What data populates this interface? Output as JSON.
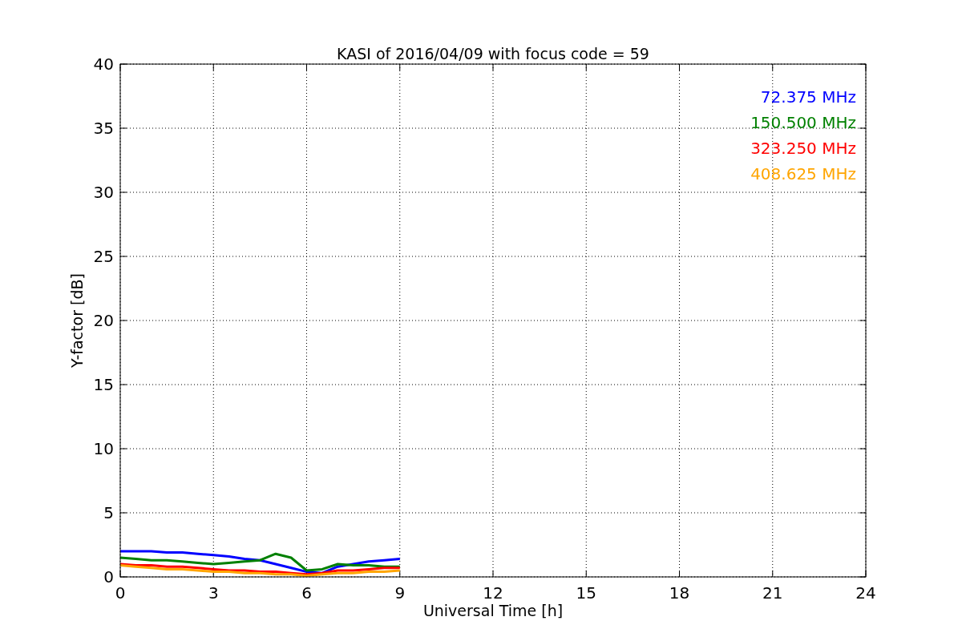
{
  "chart_data": {
    "type": "line",
    "title": "KASI of 2016/04/09 with focus code = 59",
    "xlabel": "Universal Time [h]",
    "ylabel": "Y-factor [dB]",
    "x": [
      0,
      0.5,
      1,
      1.5,
      2,
      2.5,
      3,
      3.5,
      4,
      4.5,
      5,
      5.5,
      6,
      6.5,
      7,
      7.5,
      8,
      8.5,
      9
    ],
    "series": [
      {
        "name": "72.375 MHz",
        "color": "#0000ff",
        "values": [
          2.0,
          2.0,
          2.0,
          1.9,
          1.9,
          1.8,
          1.7,
          1.6,
          1.4,
          1.3,
          1.0,
          0.7,
          0.4,
          0.3,
          0.8,
          1.0,
          1.2,
          1.3,
          1.4
        ]
      },
      {
        "name": "150.500 MHz",
        "color": "#008000",
        "values": [
          1.5,
          1.4,
          1.3,
          1.3,
          1.2,
          1.1,
          1.0,
          1.1,
          1.2,
          1.3,
          1.8,
          1.5,
          0.5,
          0.6,
          1.0,
          0.9,
          0.9,
          0.8,
          0.8
        ]
      },
      {
        "name": "323.250 MHz",
        "color": "#ff0000",
        "values": [
          1.0,
          0.9,
          0.9,
          0.8,
          0.8,
          0.7,
          0.6,
          0.5,
          0.5,
          0.4,
          0.4,
          0.3,
          0.2,
          0.3,
          0.5,
          0.5,
          0.6,
          0.7,
          0.7
        ]
      },
      {
        "name": "408.625 MHz",
        "color": "#ffa500",
        "values": [
          0.9,
          0.8,
          0.7,
          0.6,
          0.6,
          0.5,
          0.4,
          0.4,
          0.3,
          0.3,
          0.2,
          0.2,
          0.1,
          0.2,
          0.3,
          0.3,
          0.4,
          0.4,
          0.5
        ]
      }
    ],
    "xlim": [
      0,
      24
    ],
    "ylim": [
      0,
      40
    ],
    "xticks": [
      0,
      3,
      6,
      9,
      12,
      15,
      18,
      21,
      24
    ],
    "yticks": [
      0,
      5,
      10,
      15,
      20,
      25,
      30,
      35,
      40
    ],
    "grid": true
  }
}
